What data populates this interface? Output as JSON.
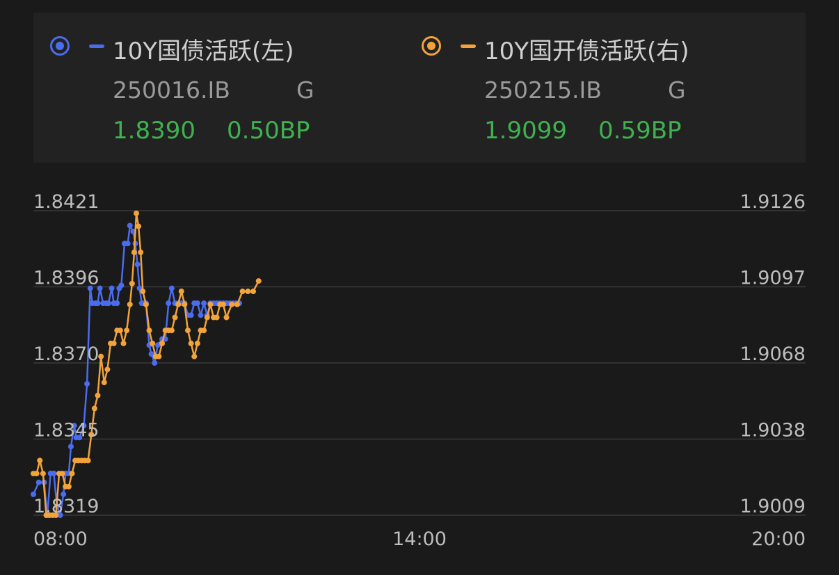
{
  "legend": {
    "left": {
      "name": "10Y国债活跃(左)",
      "code": "250016.IB",
      "tag": "G",
      "value": "1.8390",
      "change": "0.50BP",
      "color": "#4a6cf0"
    },
    "right": {
      "name": "10Y国开债活跃(右)",
      "code": "250215.IB",
      "tag": "G",
      "value": "1.9099",
      "change": "0.59BP",
      "color": "#f2a33a"
    }
  },
  "colors": {
    "value_text": "#3fb24f",
    "grid": "#3a3a3a",
    "tick_text": "#bdbdbd"
  },
  "chart_data": {
    "type": "line",
    "x_ticks": [
      "08:00",
      "14:00",
      "20:00"
    ],
    "x_range": [
      "08:00",
      "20:00"
    ],
    "y_left": {
      "ticks": [
        "1.8421",
        "1.8396",
        "1.8370",
        "1.8345",
        "1.8319"
      ],
      "range": [
        1.8319,
        1.8421
      ]
    },
    "y_right": {
      "ticks": [
        "1.9126",
        "1.9097",
        "1.9068",
        "1.9038",
        "1.9009"
      ],
      "range": [
        1.9009,
        1.9126
      ]
    },
    "grid": true,
    "series": [
      {
        "name": "10Y国债活跃(左)",
        "axis": "left",
        "color": "#4a6cf0",
        "x": [
          "08:00",
          "08:05",
          "08:10",
          "08:13",
          "08:16",
          "08:19",
          "08:22",
          "08:25",
          "08:28",
          "08:30",
          "08:33",
          "08:35",
          "08:38",
          "08:40",
          "08:43",
          "08:47",
          "08:50",
          "08:53",
          "08:55",
          "08:58",
          "09:00",
          "09:02",
          "09:05",
          "09:08",
          "09:10",
          "09:13",
          "09:15",
          "09:18",
          "09:20",
          "09:22",
          "09:25",
          "09:28",
          "09:30",
          "09:33",
          "09:35",
          "09:37",
          "09:39",
          "09:41",
          "09:43",
          "09:45",
          "09:48",
          "09:50",
          "09:53",
          "09:56",
          "10:00",
          "10:03",
          "10:06",
          "10:09",
          "10:12",
          "10:15",
          "10:18",
          "10:21",
          "10:24",
          "10:27",
          "10:30",
          "10:33",
          "10:36",
          "10:39",
          "10:42",
          "10:45",
          "10:48",
          "10:51",
          "10:54",
          "10:57",
          "11:00",
          "11:03",
          "11:06",
          "11:09",
          "11:12"
        ],
        "values": [
          1.8326,
          1.833,
          1.833,
          1.8319,
          1.8333,
          1.8333,
          1.8322,
          1.8319,
          1.8326,
          1.8333,
          1.8333,
          1.8342,
          1.8349,
          1.8345,
          1.8345,
          1.8349,
          1.8363,
          1.8395,
          1.839,
          1.839,
          1.839,
          1.8395,
          1.839,
          1.839,
          1.839,
          1.8395,
          1.839,
          1.839,
          1.8395,
          1.8396,
          1.841,
          1.841,
          1.8416,
          1.8414,
          1.841,
          1.8403,
          1.8395,
          1.839,
          1.839,
          1.839,
          1.8376,
          1.8373,
          1.837,
          1.8376,
          1.8378,
          1.8378,
          1.839,
          1.8395,
          1.839,
          1.839,
          1.839,
          1.839,
          1.8386,
          1.8386,
          1.839,
          1.839,
          1.8386,
          1.839,
          1.8386,
          1.839,
          1.839,
          1.839,
          1.839,
          1.839,
          1.839,
          1.839,
          1.839,
          1.839,
          1.839
        ]
      },
      {
        "name": "10Y国开债活跃(右)",
        "axis": "right",
        "color": "#f2a33a",
        "x": [
          "08:00",
          "08:03",
          "08:06",
          "08:09",
          "08:12",
          "08:15",
          "08:18",
          "08:21",
          "08:24",
          "08:27",
          "08:30",
          "08:33",
          "08:36",
          "08:39",
          "08:42",
          "08:45",
          "08:48",
          "08:51",
          "08:54",
          "08:57",
          "09:00",
          "09:03",
          "09:06",
          "09:09",
          "09:12",
          "09:15",
          "09:18",
          "09:21",
          "09:24",
          "09:27",
          "09:30",
          "09:32",
          "09:34",
          "09:36",
          "09:38",
          "09:40",
          "09:42",
          "09:45",
          "09:48",
          "09:51",
          "09:54",
          "09:57",
          "10:00",
          "10:03",
          "10:06",
          "10:09",
          "10:12",
          "10:15",
          "10:18",
          "10:21",
          "10:24",
          "10:27",
          "10:30",
          "10:33",
          "10:36",
          "10:39",
          "10:42",
          "10:45",
          "10:48",
          "10:51",
          "10:54",
          "10:57",
          "11:00",
          "11:05",
          "11:10",
          "11:15",
          "11:20",
          "11:25",
          "11:30"
        ],
        "values": [
          1.9025,
          1.9025,
          1.903,
          1.9025,
          1.9009,
          1.9009,
          1.9009,
          1.9009,
          1.9025,
          1.9025,
          1.902,
          1.902,
          1.9025,
          1.903,
          1.903,
          1.903,
          1.903,
          1.903,
          1.904,
          1.905,
          1.9055,
          1.907,
          1.906,
          1.9065,
          1.9075,
          1.9075,
          1.908,
          1.908,
          1.9075,
          1.908,
          1.909,
          1.9098,
          1.911,
          1.9125,
          1.912,
          1.911,
          1.9095,
          1.909,
          1.908,
          1.9075,
          1.907,
          1.907,
          1.9075,
          1.908,
          1.908,
          1.908,
          1.9085,
          1.909,
          1.9095,
          1.909,
          1.908,
          1.9075,
          1.907,
          1.9075,
          1.908,
          1.908,
          1.9085,
          1.909,
          1.9085,
          1.9085,
          1.909,
          1.909,
          1.9085,
          1.909,
          1.909,
          1.9095,
          1.9095,
          1.9095,
          1.9099
        ]
      }
    ]
  }
}
